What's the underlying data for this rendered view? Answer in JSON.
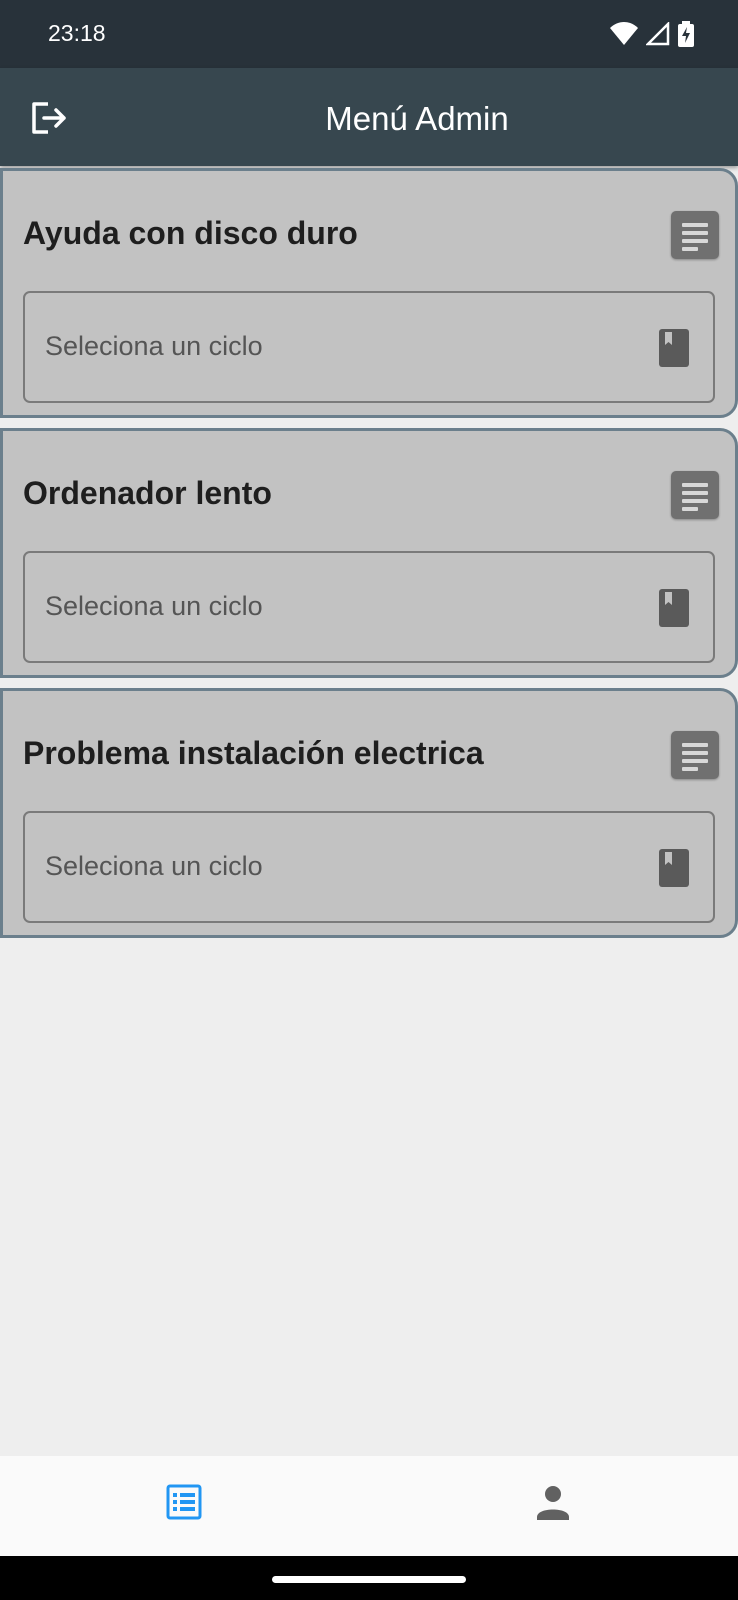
{
  "status_bar": {
    "time": "23:18",
    "icons": [
      "wifi-icon",
      "cell-signal-icon",
      "battery-charging-icon"
    ]
  },
  "app_bar": {
    "title": "Menú Admin",
    "leading_icon": "logout-icon"
  },
  "incidents": [
    {
      "title": "Ayuda con disco duro",
      "select_placeholder": "Seleciona un ciclo"
    },
    {
      "title": "Ordenador lento",
      "select_placeholder": "Seleciona un ciclo"
    },
    {
      "title": "Problema instalación electrica",
      "select_placeholder": "Seleciona un ciclo"
    }
  ],
  "bottom_nav": {
    "items": [
      {
        "icon": "list-icon",
        "active": true
      },
      {
        "icon": "person-icon",
        "active": false
      }
    ]
  },
  "colors": {
    "status_bar": "#28323a",
    "app_bar": "#37474f",
    "card_bg": "#c2c2c2",
    "card_border": "#6b7f8c",
    "nav_active": "#2196f3",
    "nav_inactive": "#616161"
  }
}
